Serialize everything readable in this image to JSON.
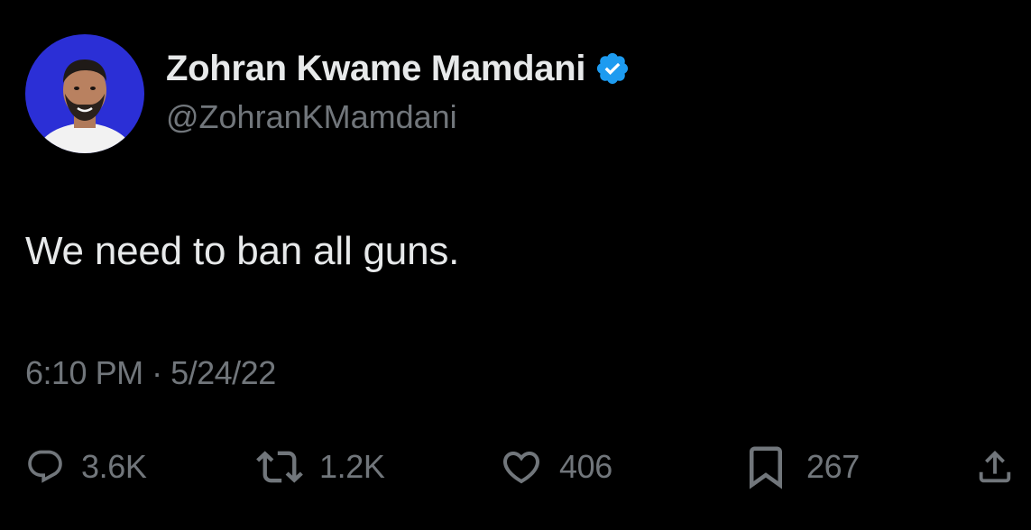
{
  "author": {
    "display_name": "Zohran Kwame Mamdani",
    "handle": "@ZohranKMamdani",
    "verified": true
  },
  "tweet": {
    "text": "We need to ban all guns.",
    "time": "6:10 PM",
    "separator": "·",
    "date": "5/24/22"
  },
  "actions": {
    "replies": "3.6K",
    "reposts": "1.2K",
    "likes": "406",
    "bookmarks": "267"
  },
  "icons": {
    "reply": "reply-icon",
    "repost": "repost-icon",
    "like": "heart-icon",
    "bookmark": "bookmark-icon",
    "share": "share-icon",
    "verified": "verified-badge-icon"
  },
  "colors": {
    "background": "#000000",
    "primary_text": "#e7e9ea",
    "secondary_text": "#71767b",
    "verified_blue": "#1d9bf0",
    "avatar_background": "#2b2fd6"
  }
}
